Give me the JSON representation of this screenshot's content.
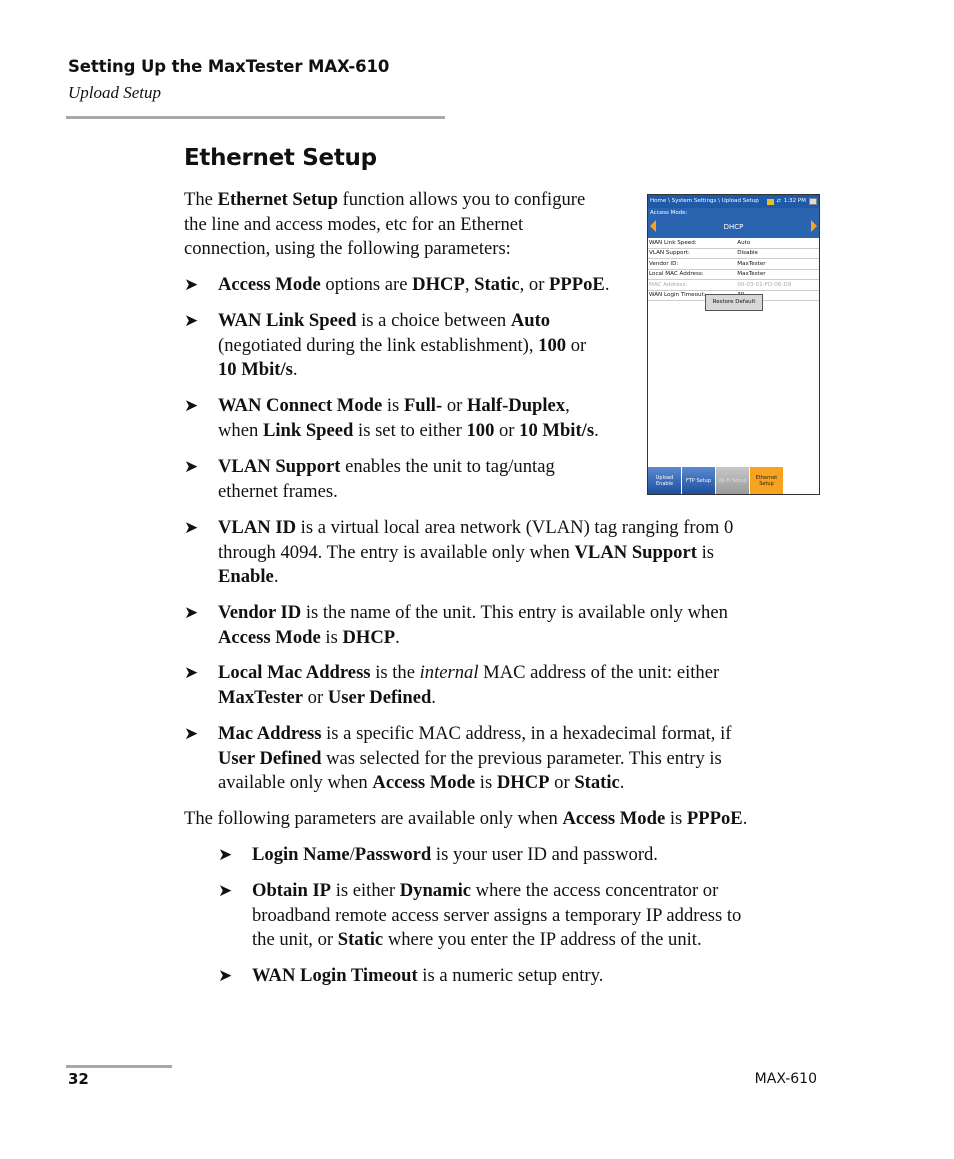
{
  "header": {
    "chapter": "Setting Up the MaxTester MAX-610",
    "section": "Upload Setup"
  },
  "title": "Ethernet Setup",
  "intro": {
    "pre": "The ",
    "bold": "Ethernet Setup",
    "line1_post": " function allows you to configure",
    "line2": "the line and access modes, etc for an Ethernet",
    "line3": "connection, using the following parameters:"
  },
  "bullets": [
    {
      "l1": [
        [
          "b",
          "Access Mode"
        ],
        [
          "t",
          " options are "
        ],
        [
          "b",
          "DHCP"
        ],
        [
          "t",
          ", "
        ],
        [
          "b",
          "Static"
        ],
        [
          "t",
          ", or "
        ],
        [
          "b",
          "PPPoE"
        ],
        [
          "t",
          "."
        ]
      ]
    },
    {
      "l1": [
        [
          "b",
          "WAN Link Speed"
        ],
        [
          "t",
          " is a choice between "
        ],
        [
          "b",
          "Auto"
        ]
      ],
      "l2": [
        [
          "t",
          "(negotiated during the link establishment), "
        ],
        [
          "b",
          "100"
        ],
        [
          "t",
          " or"
        ]
      ],
      "l3": [
        [
          "b",
          "10 Mbit/s"
        ],
        [
          "t",
          "."
        ]
      ]
    },
    {
      "l1": [
        [
          "b",
          "WAN Connect Mode"
        ],
        [
          "t",
          " is "
        ],
        [
          "b",
          "Full-"
        ],
        [
          "t",
          " or "
        ],
        [
          "b",
          "Half-Duplex"
        ],
        [
          "t",
          ","
        ]
      ],
      "l2": [
        [
          "t",
          "when "
        ],
        [
          "b",
          "Link Speed"
        ],
        [
          "t",
          " is set to either "
        ],
        [
          "b",
          "100"
        ],
        [
          "t",
          " or "
        ],
        [
          "b",
          "10 Mbit/s"
        ],
        [
          "t",
          "."
        ]
      ]
    },
    {
      "l1": [
        [
          "b",
          "VLAN Support"
        ],
        [
          "t",
          " enables the unit to tag/untag"
        ]
      ],
      "l2": [
        [
          "t",
          "ethernet frames."
        ]
      ]
    },
    {
      "l1": [
        [
          "b",
          "VLAN ID"
        ],
        [
          "t",
          " is a virtual local area network (VLAN) tag ranging from 0"
        ]
      ],
      "l2": [
        [
          "t",
          "through 4094. The entry is available only when "
        ],
        [
          "b",
          "VLAN Support"
        ],
        [
          "t",
          " is"
        ]
      ],
      "l3": [
        [
          "b",
          "Enable"
        ],
        [
          "t",
          "."
        ]
      ]
    },
    {
      "l1": [
        [
          "b",
          "Vendor ID"
        ],
        [
          "t",
          " is the name of the unit. This entry is available only when"
        ]
      ],
      "l2": [
        [
          "b",
          "Access Mode"
        ],
        [
          "t",
          " is "
        ],
        [
          "b",
          "DHCP"
        ],
        [
          "t",
          "."
        ]
      ]
    },
    {
      "l1": [
        [
          "b",
          "Local Mac Address"
        ],
        [
          "t",
          " is the "
        ],
        [
          "i",
          "internal"
        ],
        [
          "t",
          " MAC address of the unit: either"
        ]
      ],
      "l2": [
        [
          "b",
          "MaxTester"
        ],
        [
          "t",
          " or "
        ],
        [
          "b",
          "User Defined"
        ],
        [
          "t",
          "."
        ]
      ]
    },
    {
      "l1": [
        [
          "b",
          "Mac Address"
        ],
        [
          "t",
          " is a specific MAC address, in a hexadecimal format, if"
        ]
      ],
      "l2": [
        [
          "b",
          "User Defined"
        ],
        [
          "t",
          " was selected for the previous parameter. This entry is"
        ]
      ],
      "l3": [
        [
          "t",
          "available only when "
        ],
        [
          "b",
          "Access Mode"
        ],
        [
          "t",
          " is "
        ],
        [
          "b",
          "DHCP"
        ],
        [
          "t",
          " or "
        ],
        [
          "b",
          "Static"
        ],
        [
          "t",
          "."
        ]
      ]
    }
  ],
  "pppoe_intro": [
    [
      "t",
      "The following parameters are available only when "
    ],
    [
      "b",
      "Access Mode"
    ],
    [
      "t",
      " is "
    ],
    [
      "b",
      "PPPoE"
    ],
    [
      "t",
      "."
    ]
  ],
  "sub_bullets": [
    {
      "l1": [
        [
          "b",
          "Login Name"
        ],
        [
          "t",
          "/"
        ],
        [
          "b",
          "Password"
        ],
        [
          "t",
          " is your user ID and password."
        ]
      ]
    },
    {
      "l1": [
        [
          "b",
          "Obtain IP"
        ],
        [
          "t",
          " is either "
        ],
        [
          "b",
          "Dynamic"
        ],
        [
          "t",
          " where the access concentrator or"
        ]
      ],
      "l2": [
        [
          "t",
          "broadband remote access server assigns a temporary IP address to"
        ]
      ],
      "l3": [
        [
          "t",
          "the unit, or "
        ],
        [
          "b",
          "Static"
        ],
        [
          "t",
          " where you enter the IP address of the unit."
        ]
      ]
    },
    {
      "l1": [
        [
          "b",
          "WAN Login Timeout"
        ],
        [
          "t",
          " is a numeric setup entry."
        ]
      ]
    }
  ],
  "bullet_glyph": "➤",
  "device": {
    "breadcrumb": "Home \\ System Settings \\ Upload Setup",
    "time": "1:32 PM",
    "access_mode_label": "Access Mode:",
    "access_mode_value": "DHCP",
    "rows": [
      {
        "label": "WAN Link Speed:",
        "value": "Auto"
      },
      {
        "label": "VLAN Support:",
        "value": "Disable"
      },
      {
        "label": "Vendor ID:",
        "value": "MaxTester"
      },
      {
        "label": "Local MAC Address:",
        "value": "MaxTester"
      },
      {
        "label": "MAC Address:",
        "value": "00-03-01-FD-06-D9",
        "disabled": true
      },
      {
        "label": "WAN Login Timeout:",
        "value": "30",
        "unit": "sec"
      }
    ],
    "restore_button": "Restore Default",
    "tabs": [
      {
        "label": "Upload Enable",
        "state": "normal"
      },
      {
        "label": "FTP Setup",
        "state": "normal"
      },
      {
        "label": "Wi-Fi Setup",
        "state": "disabled"
      },
      {
        "label": "Ethernet Setup",
        "state": "active"
      }
    ],
    "colors": {
      "header_blue": "#1e5aa8",
      "accent_orange": "#f7a320"
    }
  },
  "footer": {
    "page_number": "32",
    "doc_id": "MAX-610"
  }
}
